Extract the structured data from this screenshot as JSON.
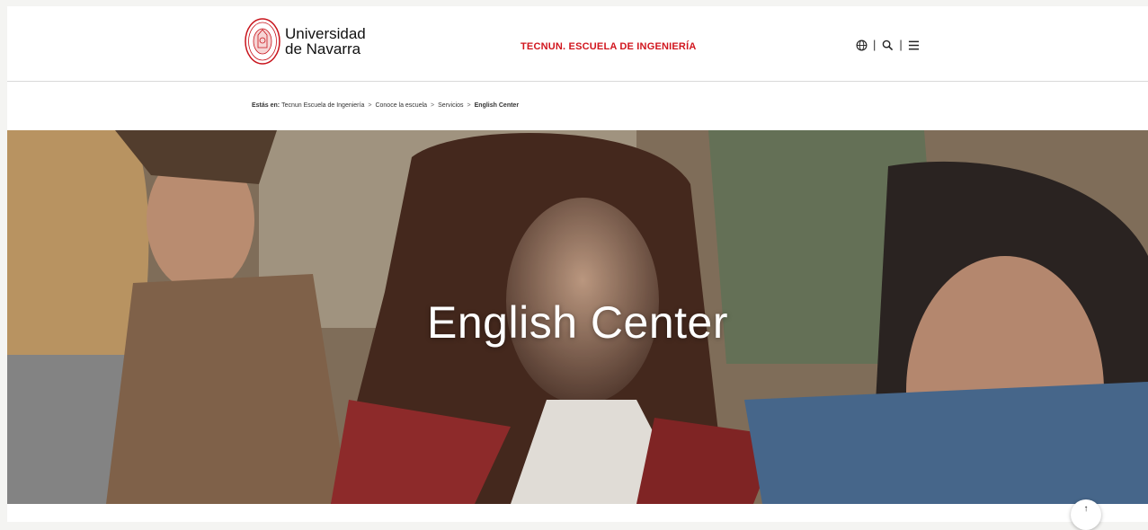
{
  "header": {
    "logo": {
      "line1": "Universidad",
      "line2": "de Navarra"
    },
    "school_title": "TECNUN. ESCUELA DE INGENIERÍA",
    "tools": [
      {
        "icon": "globe-icon"
      },
      {
        "icon": "search-icon"
      },
      {
        "icon": "menu-icon"
      }
    ],
    "separator": "|"
  },
  "breadcrumb": {
    "lead": "Estás en:",
    "items": [
      "Tecnun Escuela de Ingeniería",
      "Conoce la escuela",
      "Servicios"
    ],
    "current": "English Center",
    "arrow": ">"
  },
  "hero": {
    "title": "English Center"
  },
  "scroll_top": {
    "icon": "arrow-up-icon",
    "glyph": "↑"
  },
  "colors": {
    "brand_red": "#d1161e",
    "text": "#111111",
    "background": "#ffffff"
  }
}
